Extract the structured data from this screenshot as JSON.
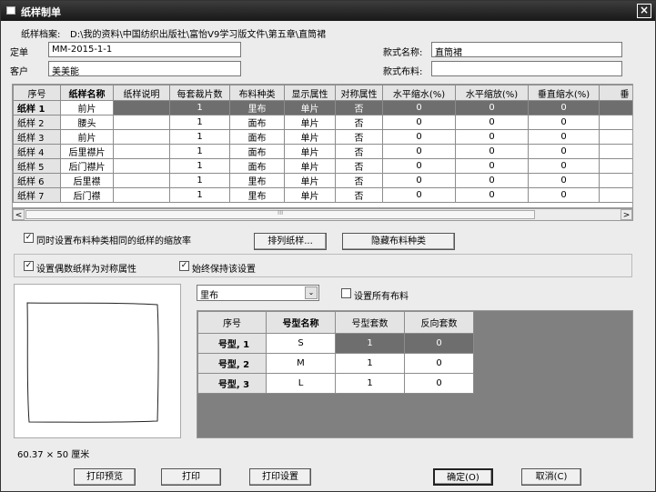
{
  "window": {
    "title": "纸样制单",
    "close_glyph": "×"
  },
  "header": {
    "archive_label": "纸样档案:",
    "archive_path": "D:\\我的资料\\中国纺织出版社\\富怡V9学习版文件\\第五章\\直筒裙",
    "order_label": "定单",
    "order_value": "MM-2015-1-1",
    "customer_label": "客户",
    "customer_value": "美美能",
    "style_name_label": "款式名称:",
    "style_name_value": "直筒裙",
    "style_fabric_label": "款式布料:",
    "style_fabric_value": ""
  },
  "pieces_table": {
    "columns": [
      "序号",
      "纸样名称",
      "纸样说明",
      "每套裁片数",
      "布料种类",
      "显示属性",
      "对称属性",
      "水平缩水(%)",
      "水平缩放(%)",
      "垂直缩水(%)",
      "垂"
    ],
    "rows": [
      [
        "纸样 1",
        "前片",
        "",
        "1",
        "里布",
        "单片",
        "否",
        "0",
        "0",
        "0"
      ],
      [
        "纸样 2",
        "腰头",
        "",
        "1",
        "面布",
        "单片",
        "否",
        "0",
        "0",
        "0"
      ],
      [
        "纸样 3",
        "前片",
        "",
        "1",
        "面布",
        "单片",
        "否",
        "0",
        "0",
        "0"
      ],
      [
        "纸样 4",
        "后里襟片",
        "",
        "1",
        "面布",
        "单片",
        "否",
        "0",
        "0",
        "0"
      ],
      [
        "纸样 5",
        "后门襟片",
        "",
        "1",
        "面布",
        "单片",
        "否",
        "0",
        "0",
        "0"
      ],
      [
        "纸样 6",
        "后里襟",
        "",
        "1",
        "里布",
        "单片",
        "否",
        "0",
        "0",
        "0"
      ],
      [
        "纸样 7",
        "后门襟",
        "",
        "1",
        "里布",
        "单片",
        "否",
        "0",
        "0",
        "0"
      ]
    ]
  },
  "scrollbar": {
    "left_arrow": "<",
    "right_arrow": ">",
    "thumb_mark": "III"
  },
  "options": {
    "same_fabric_scale": "同时设置布料种类相同的纸样的缩放率",
    "sort_button": "排列纸样...",
    "hide_fabric_button": "隐藏布料种类",
    "even_symmetric": "设置偶数纸样为对称属性",
    "keep_setting": "始终保持该设置",
    "check_glyph": "✓"
  },
  "preview": {
    "size_text": "60.37 × 50 厘米"
  },
  "fabric_select": {
    "value": "里布",
    "dropdown_glyph": "⌄",
    "set_all_label": "设置所有布料"
  },
  "sizes_table": {
    "columns": [
      "序号",
      "号型名称",
      "号型套数",
      "反向套数"
    ],
    "rows": [
      [
        "号型, 1",
        "S",
        "1",
        "0"
      ],
      [
        "号型, 2",
        "M",
        "1",
        "0"
      ],
      [
        "号型, 3",
        "L",
        "1",
        "0"
      ]
    ]
  },
  "footer": {
    "print_preview": "打印预览",
    "print": "打印",
    "print_setup": "打印设置",
    "ok": "确定(O)",
    "cancel": "取消(C)"
  }
}
